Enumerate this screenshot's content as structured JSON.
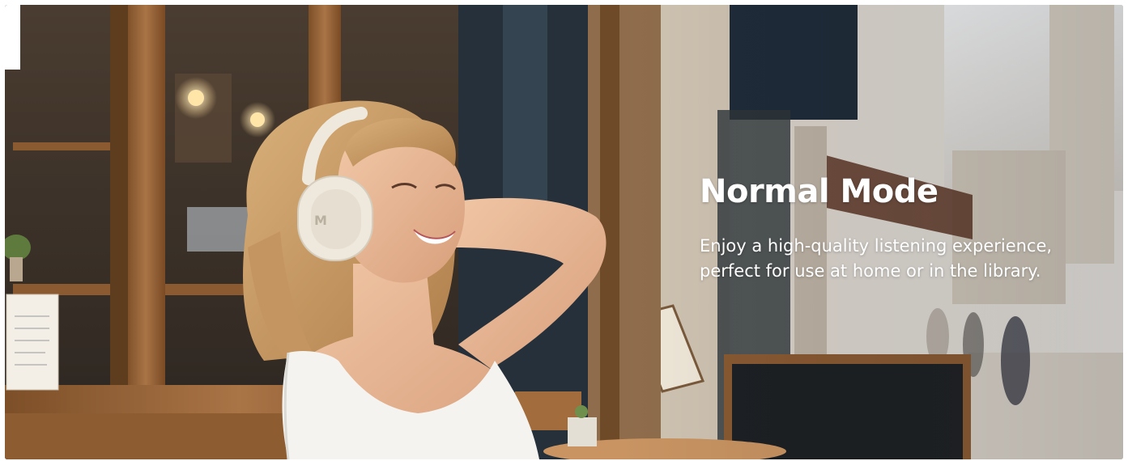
{
  "banner": {
    "title": "Normal Mode",
    "description": "Enjoy a high-quality listening experience, perfect for use at home or in the library.",
    "image_subject": "Smiling woman wearing cream-colored over-ear headphones sitting outside a café",
    "headphone_logo": "M"
  },
  "colors": {
    "text": "#ffffff",
    "headphone": "#efe9dd",
    "wood_frame": "#9c6a3c"
  }
}
